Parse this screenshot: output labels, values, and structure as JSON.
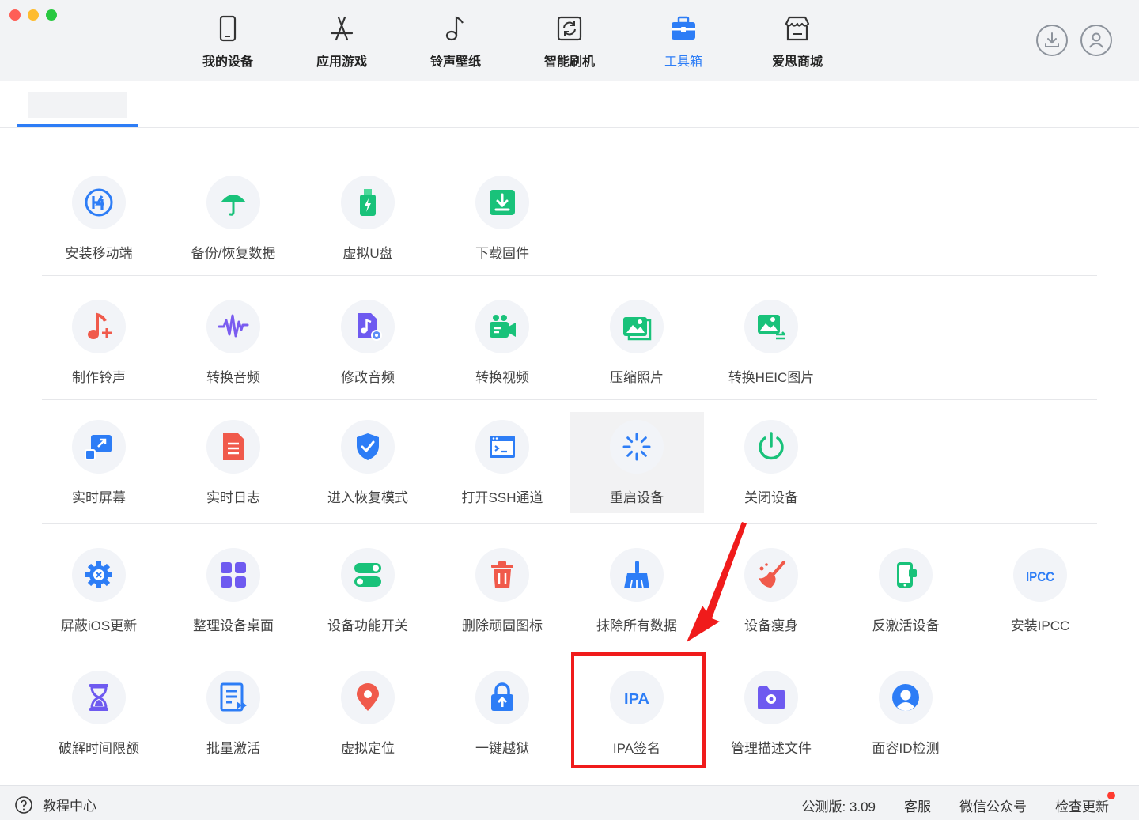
{
  "nav": {
    "items": [
      {
        "label": "我的设备",
        "icon": "phone-icon"
      },
      {
        "label": "应用游戏",
        "icon": "app-store-icon"
      },
      {
        "label": "铃声壁纸",
        "icon": "music-note-icon"
      },
      {
        "label": "智能刷机",
        "icon": "refresh-icon"
      },
      {
        "label": "工具箱",
        "icon": "toolbox-icon",
        "active": true
      },
      {
        "label": "爱思商城",
        "icon": "shop-icon"
      }
    ],
    "accent": "#2d7df6"
  },
  "tools": {
    "row1": [
      "安装移动端",
      "备份/恢复数据",
      "虚拟U盘",
      "下载固件"
    ],
    "row2": [
      "制作铃声",
      "转换音频",
      "修改音频",
      "转换视频",
      "压缩照片",
      "转换HEIC图片"
    ],
    "row3": [
      "实时屏幕",
      "实时日志",
      "进入恢复模式",
      "打开SSH通道",
      "重启设备",
      "关闭设备"
    ],
    "row4": [
      "屏蔽iOS更新",
      "整理设备桌面",
      "设备功能开关",
      "删除顽固图标",
      "抹除所有数据",
      "设备瘦身",
      "反激活设备",
      "安装IPCC"
    ],
    "row5": [
      "破解时间限额",
      "批量激活",
      "虚拟定位",
      "一键越狱",
      "IPA签名",
      "管理描述文件",
      "面容ID检测"
    ],
    "ipcc_text": "IPCC",
    "ipa_text": "IPA"
  },
  "footer": {
    "help": "教程中心",
    "version": "公测版: 3.09",
    "service": "客服",
    "wechat": "微信公众号",
    "update": "检查更新"
  }
}
